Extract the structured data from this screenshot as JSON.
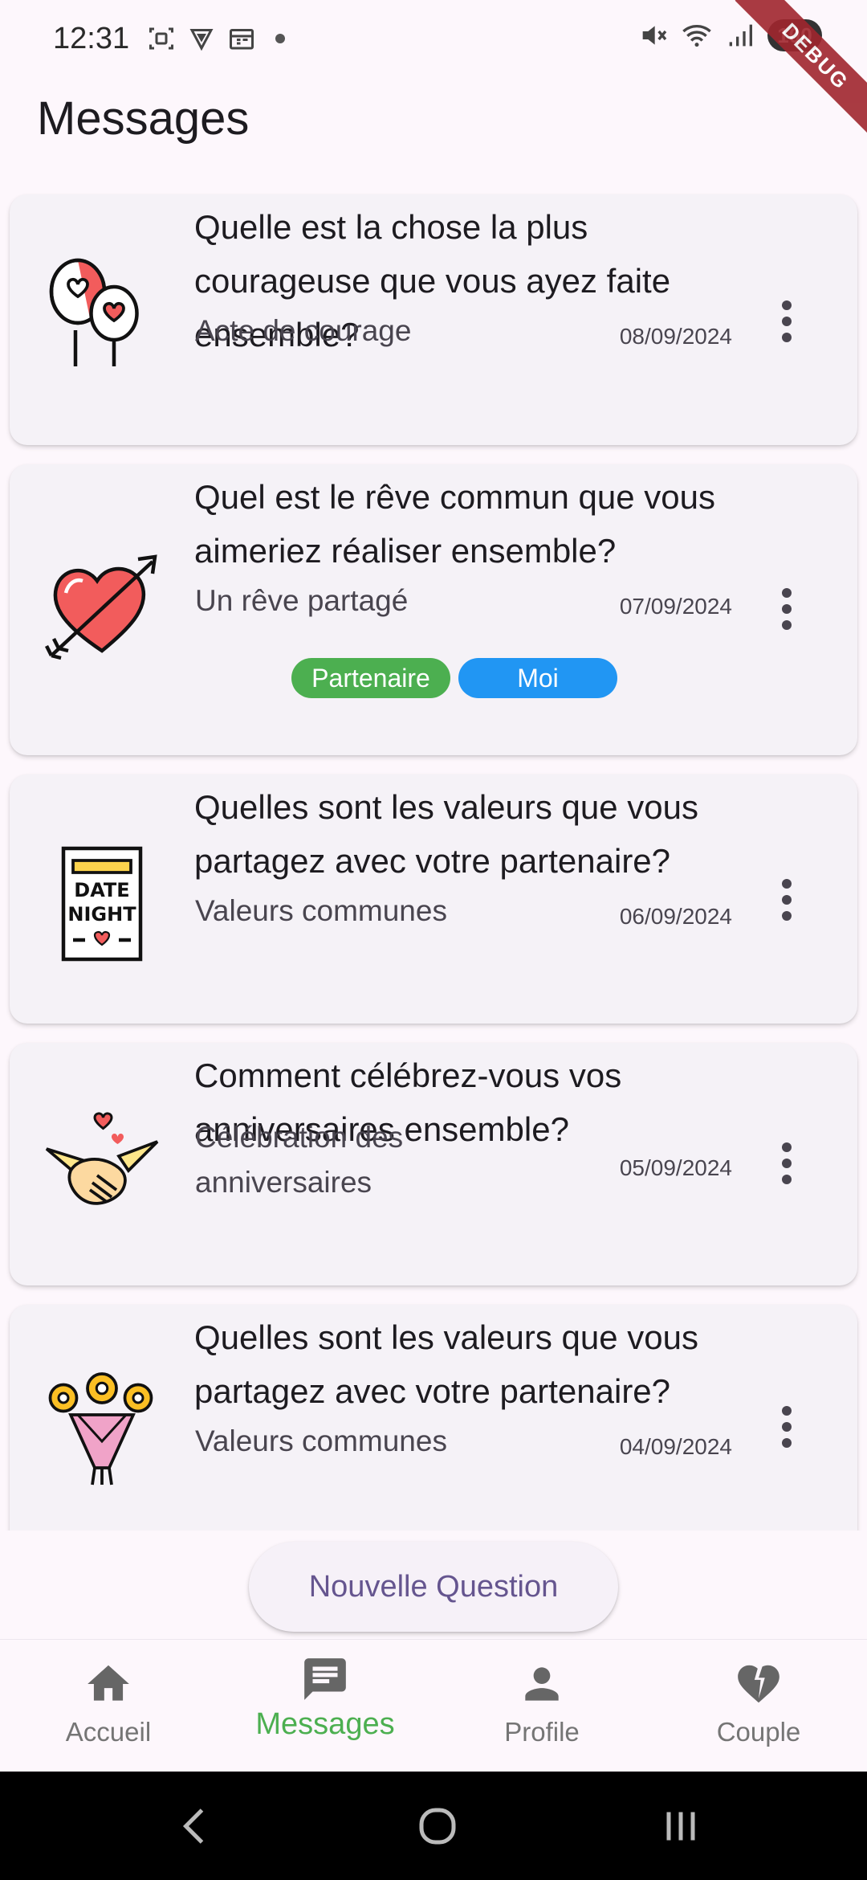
{
  "status_bar": {
    "time": "12:31",
    "battery": "100",
    "debug_label": "DEBUG"
  },
  "header": {
    "title": "Messages"
  },
  "cards": [
    {
      "title": "Quelle est la chose la plus courageuse que vous ayez faite ensemble?",
      "subtitle": "Acte de courage",
      "date": "08/09/2024",
      "icon": "balloons-heart-icon"
    },
    {
      "title": "Quel est le rêve commun que vous aimeriez réaliser ensemble?",
      "subtitle": "Un rêve partagé",
      "date": "07/09/2024",
      "icon": "heart-arrow-icon",
      "tags": [
        {
          "label": "Partenaire",
          "color": "#4caf50"
        },
        {
          "label": "Moi",
          "color": "#2196f3"
        }
      ]
    },
    {
      "title": "Quelles sont les valeurs que vous partagez avec votre partenaire?",
      "subtitle": "Valeurs communes",
      "date": "06/09/2024",
      "icon": "date-night-sign-icon",
      "icon_text_1": "DATE",
      "icon_text_2": "NIGHT"
    },
    {
      "title": "Comment célébrez-vous vos anniversaires ensemble?",
      "subtitle": "Célébration des anniversaires",
      "date": "05/09/2024",
      "icon": "holding-hands-icon"
    },
    {
      "title": "Quelles sont les valeurs que vous partagez avec votre partenaire?",
      "subtitle": "Valeurs communes",
      "date": "04/09/2024",
      "icon": "flower-bouquet-icon"
    }
  ],
  "new_question_button": "Nouvelle Question",
  "bottom_nav": [
    {
      "label": "Accueil",
      "icon": "home-icon",
      "active": false
    },
    {
      "label": "Messages",
      "icon": "message-icon",
      "active": true
    },
    {
      "label": "Profile",
      "icon": "person-icon",
      "active": false
    },
    {
      "label": "Couple",
      "icon": "broken-heart-icon",
      "active": false
    }
  ],
  "colors": {
    "accent_active": "#4caf50",
    "button_text": "#65558f",
    "heart_red": "#f25c5c"
  }
}
